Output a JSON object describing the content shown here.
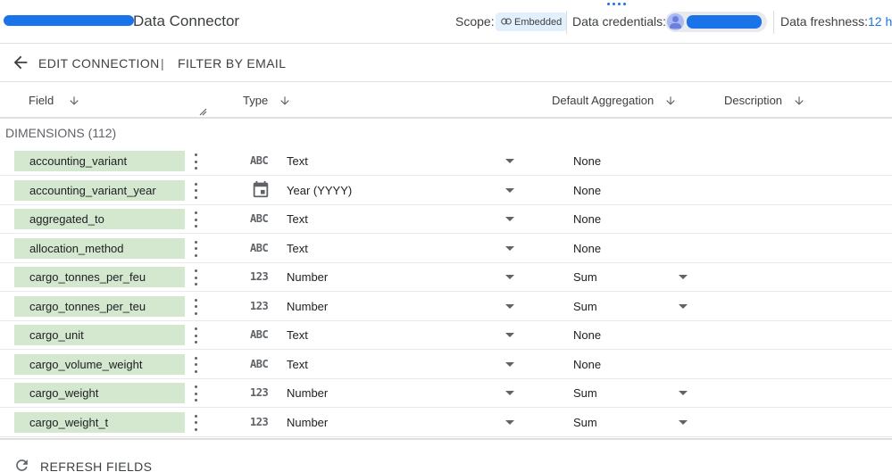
{
  "header": {
    "title": "Data Connector",
    "scope_label": "Scope:",
    "scope_value": "Embedded",
    "credentials_label": "Data credentials:",
    "freshness_label": "Data freshness:",
    "freshness_value": "12 h"
  },
  "subheader": {
    "edit_connection": "EDIT CONNECTION",
    "separator": "|",
    "filter_by_email": "FILTER BY EMAIL"
  },
  "columns": {
    "field": "Field",
    "type": "Type",
    "default_aggregation": "Default Aggregation",
    "description": "Description"
  },
  "dimensions_label": "DIMENSIONS (112)",
  "rows": [
    {
      "field": "accounting_variant",
      "type_icon": "ABC",
      "type": "Text",
      "aggregation": "None",
      "agg_dropdown": false
    },
    {
      "field": "accounting_variant_year",
      "type_icon": "calendar-icon",
      "type": "Year (YYYY)",
      "aggregation": "None",
      "agg_dropdown": false
    },
    {
      "field": "aggregated_to",
      "type_icon": "ABC",
      "type": "Text",
      "aggregation": "None",
      "agg_dropdown": false
    },
    {
      "field": "allocation_method",
      "type_icon": "ABC",
      "type": "Text",
      "aggregation": "None",
      "agg_dropdown": false
    },
    {
      "field": "cargo_tonnes_per_feu",
      "type_icon": "123",
      "type": "Number",
      "aggregation": "Sum",
      "agg_dropdown": true
    },
    {
      "field": "cargo_tonnes_per_teu",
      "type_icon": "123",
      "type": "Number",
      "aggregation": "Sum",
      "agg_dropdown": true
    },
    {
      "field": "cargo_unit",
      "type_icon": "ABC",
      "type": "Text",
      "aggregation": "None",
      "agg_dropdown": false
    },
    {
      "field": "cargo_volume_weight",
      "type_icon": "ABC",
      "type": "Text",
      "aggregation": "None",
      "agg_dropdown": false
    },
    {
      "field": "cargo_weight",
      "type_icon": "123",
      "type": "Number",
      "aggregation": "Sum",
      "agg_dropdown": true
    },
    {
      "field": "cargo_weight_t",
      "type_icon": "123",
      "type": "Number",
      "aggregation": "Sum",
      "agg_dropdown": true
    }
  ],
  "footer": {
    "refresh_fields": "REFRESH FIELDS"
  },
  "colors": {
    "accent": "#1a73e8",
    "field_chip": "#d4e8cf",
    "scope_chip": "#e2effd"
  }
}
